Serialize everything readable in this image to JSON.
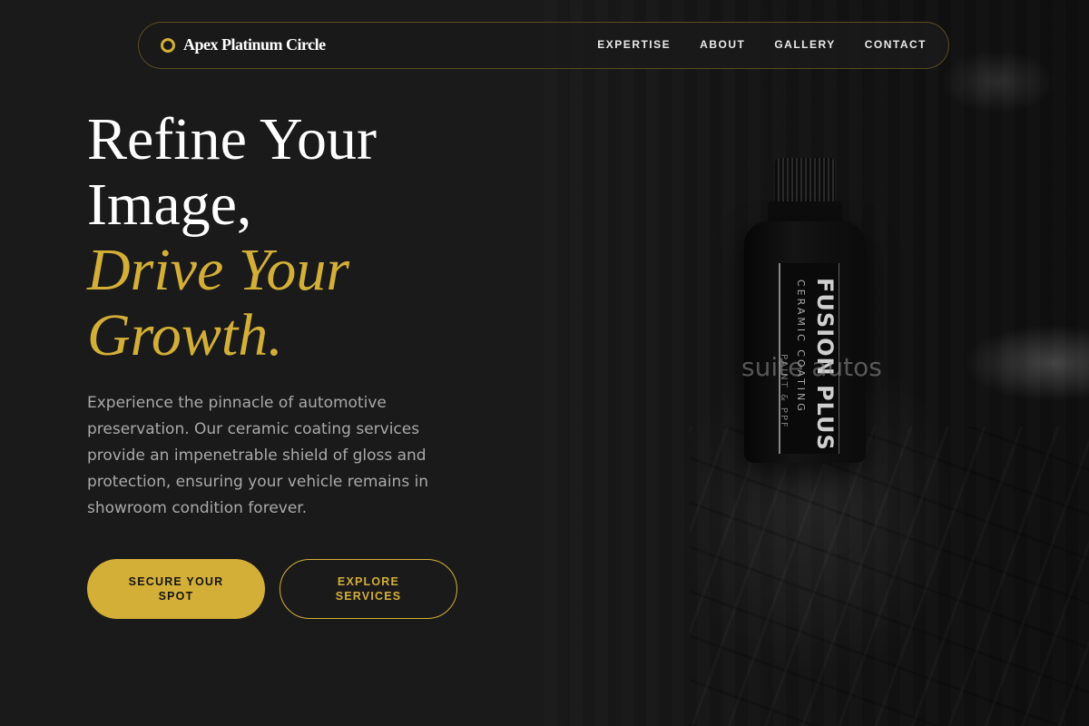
{
  "brand": {
    "name": "Apex Platinum Circle"
  },
  "nav": {
    "links": [
      "EXPERTISE",
      "ABOUT",
      "GALLERY",
      "CONTACT"
    ]
  },
  "hero": {
    "title_line1": "Refine Your",
    "title_line2": "Image,",
    "accent_line1": "Drive Your",
    "accent_line2": "Growth.",
    "description": "Experience the pinnacle of automotive preservation. Our ceramic coating services provide an impenetrable shield of gloss and protection, ensuring your vehicle remains in showroom condition forever.",
    "primary_button": "SECURE YOUR SPOT",
    "secondary_button": "EXPLORE SERVICES"
  },
  "image": {
    "bottle_brand": "FUSION PLUS",
    "bottle_subtitle": "CERAMIC COATING",
    "bottle_small": "PAINT & PPF",
    "watermark": "suite autos"
  },
  "colors": {
    "accent": "#d4af37",
    "background": "#1a1a1a"
  }
}
